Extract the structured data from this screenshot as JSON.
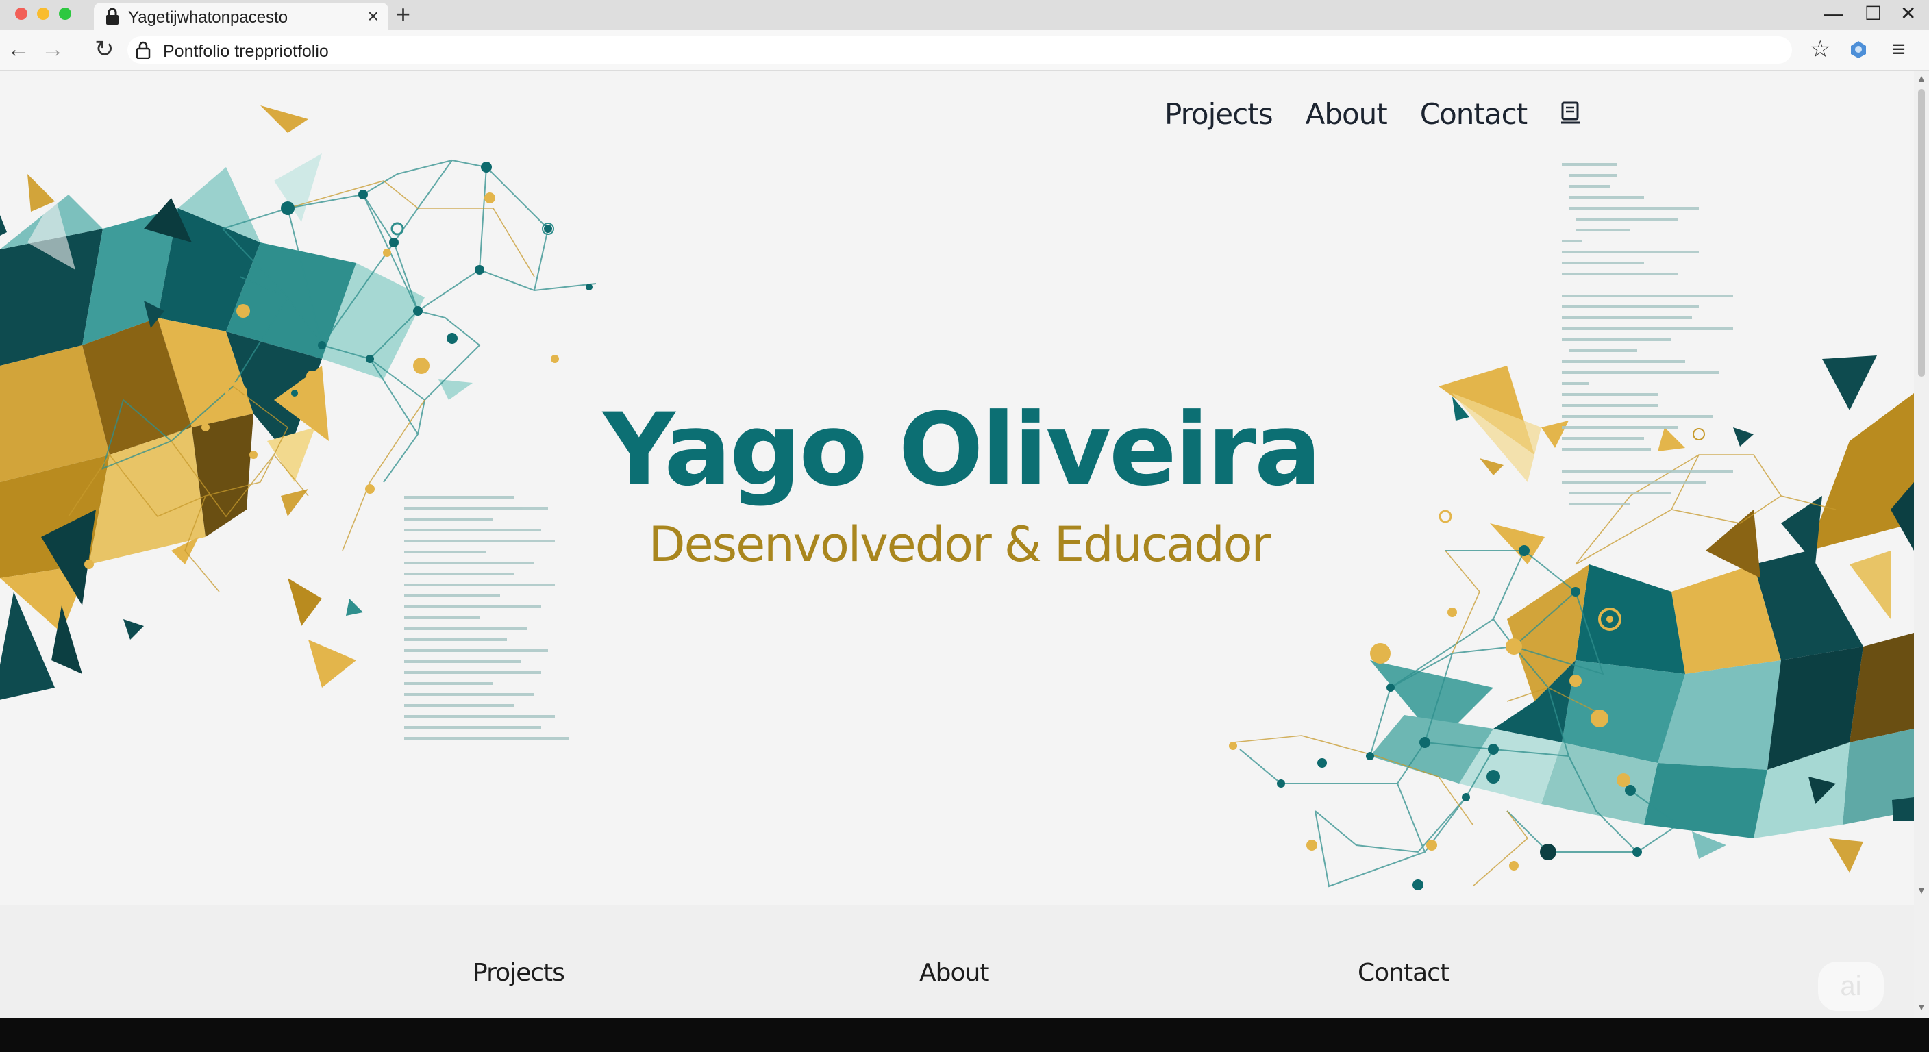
{
  "browser": {
    "tab_title": "Yagetijwhatonpacesto",
    "address": "Pontfolio treppriotfolio",
    "close_glyph": "×",
    "newtab_glyph": "+",
    "back_glyph": "←",
    "forward_glyph": "→",
    "reload_glyph": "↻",
    "star_glyph": "☆",
    "menu_glyph": "≡",
    "minimize_glyph": "—",
    "maximize_glyph": "☐",
    "window_close_glyph": "✕"
  },
  "nav": {
    "items": [
      "Projects",
      "About",
      "Contact"
    ],
    "extra_icon": "document-icon"
  },
  "hero": {
    "name": "Yago Oliveira",
    "role": "Desenvolvedor & Educador"
  },
  "footer": {
    "links": [
      "Projects",
      "About",
      "Contact"
    ]
  },
  "theme": {
    "teal": "#0c6f73",
    "gold": "#a9861e",
    "dark_teal": "#0e4b4f",
    "light_teal": "#7cc0bd",
    "light_gold": "#e3b54b"
  },
  "watermark": "ai"
}
